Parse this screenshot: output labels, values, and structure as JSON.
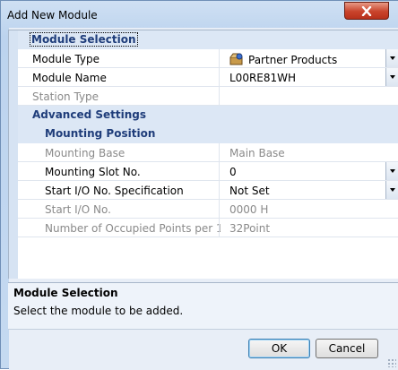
{
  "window": {
    "title": "Add New Module"
  },
  "property_grid": {
    "categories": {
      "module_selection": "Module Selection",
      "advanced_settings": "Advanced Settings",
      "mounting_position": "Mounting Position"
    },
    "rows": {
      "module_type": {
        "label": "Module Type",
        "value": "Partner Products"
      },
      "module_name": {
        "label": "Module Name",
        "value": "L00RE81WH"
      },
      "station_type": {
        "label": "Station Type",
        "value": ""
      },
      "mounting_base": {
        "label": "Mounting Base",
        "value": "Main Base"
      },
      "mounting_slot": {
        "label": "Mounting Slot No.",
        "value": "0"
      },
      "start_io_spec": {
        "label": "Start I/O No. Specification",
        "value": "Not Set"
      },
      "start_io_no": {
        "label": "Start I/O No.",
        "value": "0000 H"
      },
      "occupied_points": {
        "label": "Number of Occupied Points per 1",
        "value": "32Point"
      }
    }
  },
  "description": {
    "title": "Module Selection",
    "text": "Select the module to be added."
  },
  "buttons": {
    "ok": "OK",
    "cancel": "Cancel"
  },
  "colors": {
    "category_text": "#1f3d7a",
    "close_button": "#c9432b",
    "readonly_text": "#8a8a8a"
  }
}
